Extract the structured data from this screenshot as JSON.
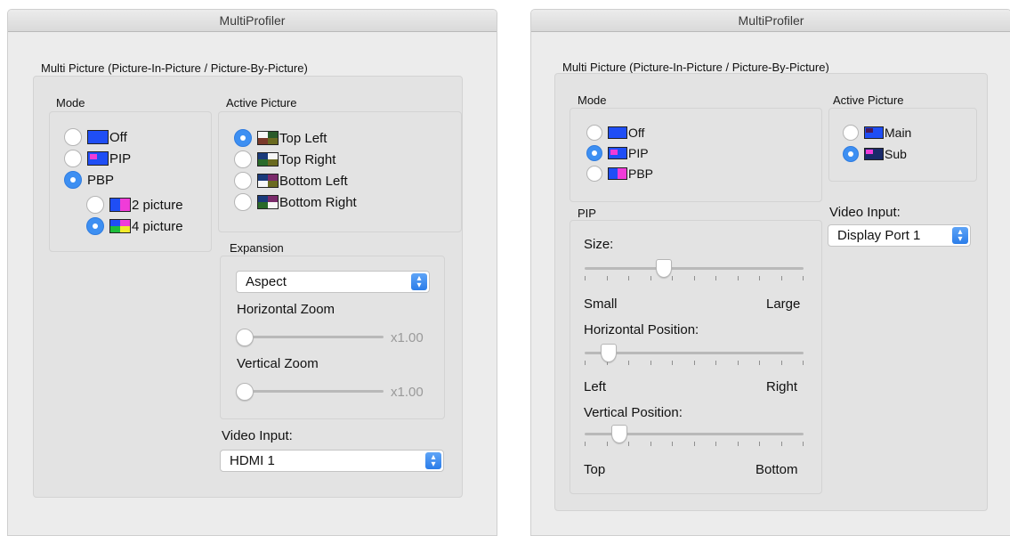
{
  "left_window": {
    "title": "MultiProfiler",
    "group_title": "Multi Picture (Picture-In-Picture / Picture-By-Picture)",
    "mode": {
      "title": "Mode",
      "options": [
        {
          "label": "Off",
          "selected": false,
          "icon": "monitor-off-icon"
        },
        {
          "label": "PIP",
          "selected": false,
          "icon": "monitor-pip-icon"
        },
        {
          "label": "PBP",
          "selected": true,
          "icon": ""
        }
      ],
      "sub_options": [
        {
          "label": "2 picture",
          "selected": false,
          "icon": "monitor-2-picture-icon"
        },
        {
          "label": "4 picture",
          "selected": true,
          "icon": "monitor-4-picture-icon"
        }
      ]
    },
    "active_picture": {
      "title": "Active Picture",
      "options": [
        {
          "label": "Top Left",
          "selected": true,
          "icon": "quad-top-left-icon"
        },
        {
          "label": "Top Right",
          "selected": false,
          "icon": "quad-top-right-icon"
        },
        {
          "label": "Bottom Left",
          "selected": false,
          "icon": "quad-bottom-left-icon"
        },
        {
          "label": "Bottom Right",
          "selected": false,
          "icon": "quad-bottom-right-icon"
        }
      ]
    },
    "expansion": {
      "title": "Expansion",
      "select_value": "Aspect",
      "horizontal_zoom": {
        "label": "Horizontal Zoom",
        "value": "x1.00",
        "level": 0
      },
      "vertical_zoom": {
        "label": "Vertical Zoom",
        "value": "x1.00",
        "level": 0
      }
    },
    "video_input": {
      "label": "Video Input:",
      "value": "HDMI 1"
    }
  },
  "right_window": {
    "title": "MultiProfiler",
    "group_title": "Multi Picture (Picture-In-Picture / Picture-By-Picture)",
    "mode": {
      "title": "Mode",
      "options": [
        {
          "label": "Off",
          "selected": false,
          "icon": "monitor-off-icon"
        },
        {
          "label": "PIP",
          "selected": true,
          "icon": "monitor-pip-icon"
        },
        {
          "label": "PBP",
          "selected": false,
          "icon": "monitor-pbp-icon"
        }
      ]
    },
    "active_picture": {
      "title": "Active Picture",
      "options": [
        {
          "label": "Main",
          "selected": false,
          "icon": "pip-main-icon"
        },
        {
          "label": "Sub",
          "selected": true,
          "icon": "pip-sub-icon"
        }
      ]
    },
    "pip": {
      "title": "PIP",
      "size": {
        "label": "Size:",
        "min_label": "Small",
        "max_label": "Large",
        "level": 0.35
      },
      "horizontal_position": {
        "label": "Horizontal Position:",
        "min_label": "Left",
        "max_label": "Right",
        "level": 0.08
      },
      "vertical_position": {
        "label": "Vertical Position:",
        "min_label": "Top",
        "max_label": "Bottom",
        "level": 0.13
      }
    },
    "video_input": {
      "label": "Video Input:",
      "value": "Display Port 1"
    }
  },
  "colors": {
    "accent": "#3d8ff2",
    "panel_bg": "#ececec",
    "group_bg": "#e3e3e3"
  }
}
